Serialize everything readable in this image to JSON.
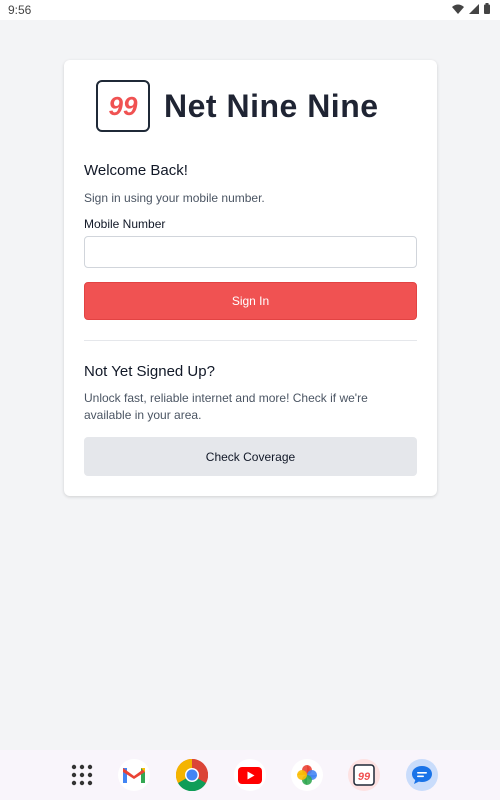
{
  "status_bar": {
    "time": "9:56",
    "icons": [
      "wifi-icon",
      "signal-icon",
      "battery-icon"
    ]
  },
  "brand": {
    "logo_mark": "99",
    "name": "Net Nine Nine",
    "accent_color": "#f05252"
  },
  "signin": {
    "title": "Welcome Back!",
    "subtitle": "Sign in using your mobile number.",
    "mobile_label": "Mobile Number",
    "mobile_value": "",
    "mobile_placeholder": "",
    "button_label": "Sign In"
  },
  "signup": {
    "title": "Not Yet Signed Up?",
    "description": "Unlock fast, reliable internet and more! Check if we're available in your area.",
    "button_label": "Check Coverage"
  },
  "dock": {
    "apps": [
      "app-drawer-icon",
      "gmail-icon",
      "chrome-icon",
      "youtube-icon",
      "photos-icon",
      "netninenine-app-icon",
      "messages-icon"
    ]
  }
}
